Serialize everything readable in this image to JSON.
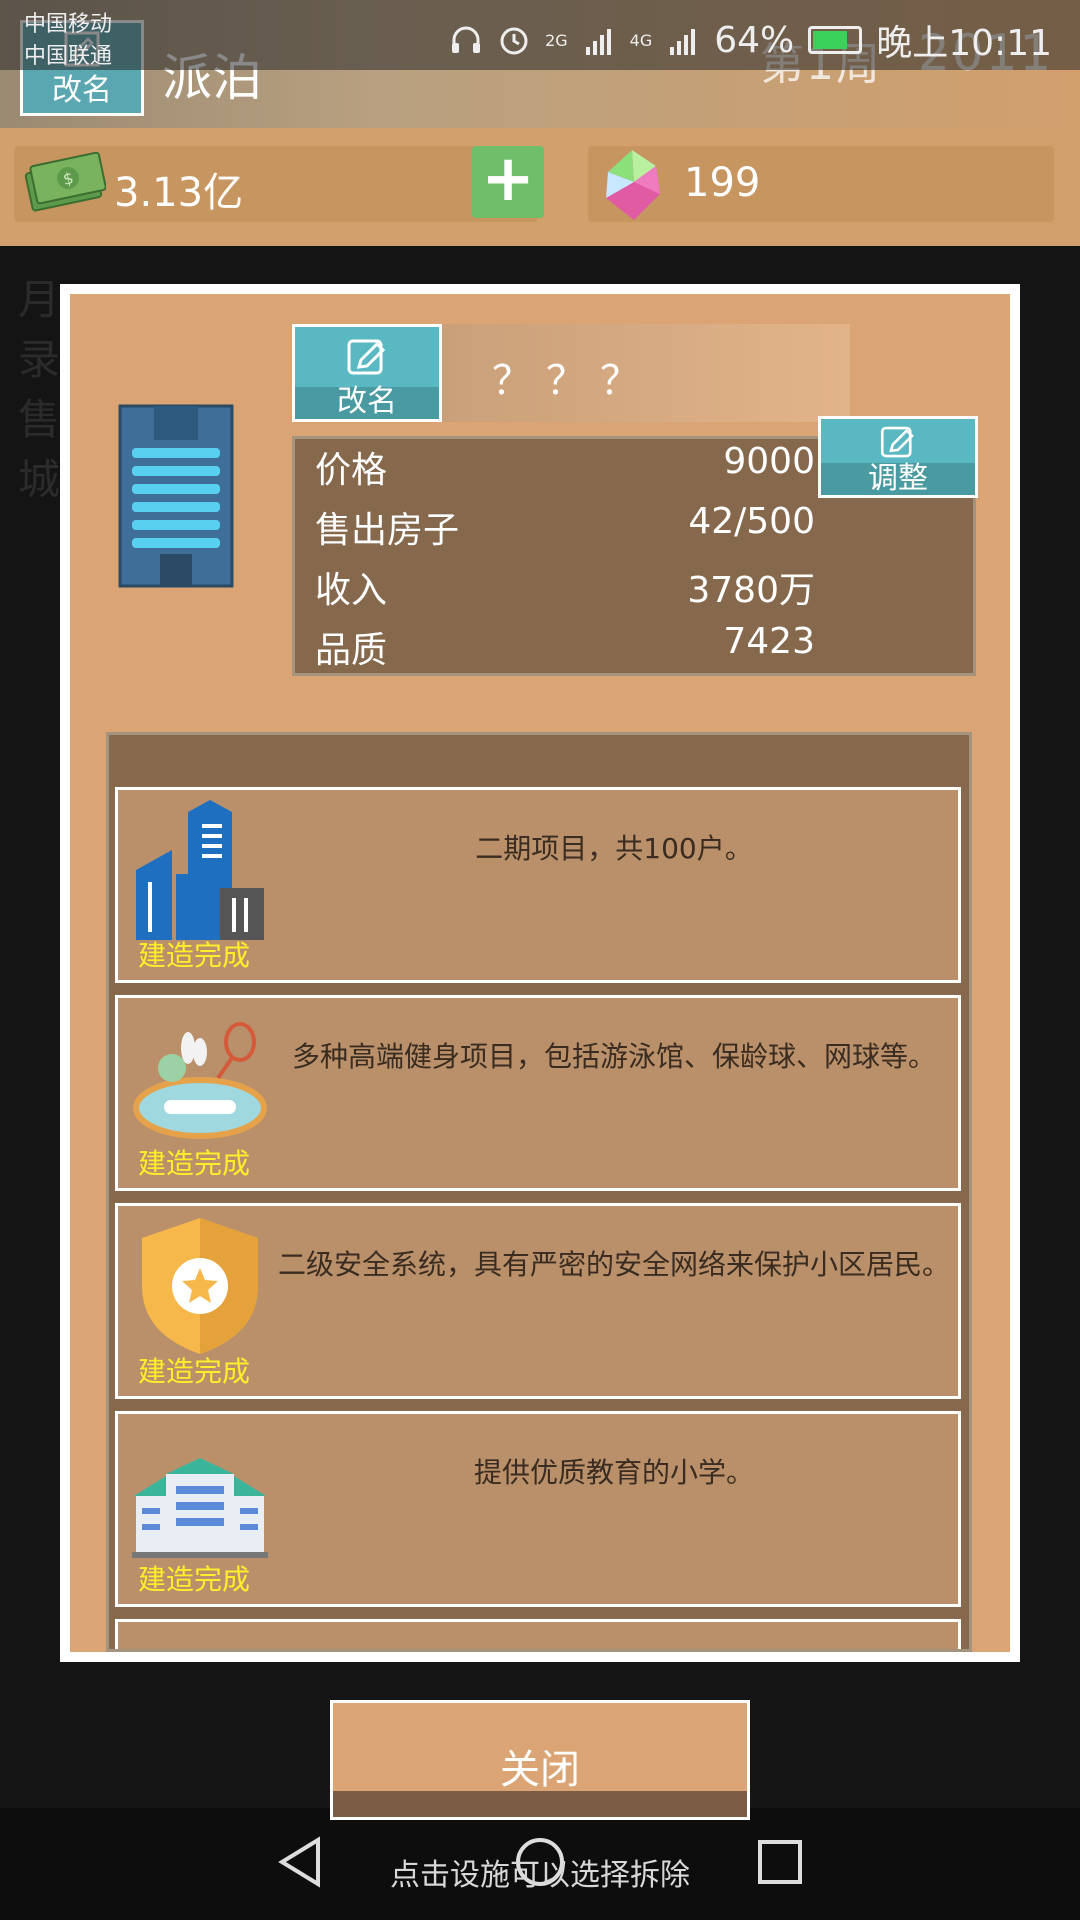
{
  "status_bar": {
    "carrier_1": "中国移动",
    "carrier_2": "中国联通",
    "signal_2g": "2G",
    "signal_4g": "4G",
    "battery_pct": "64%",
    "time": "晚上10:11"
  },
  "header": {
    "rename_label": "改名",
    "company_name": "派泊",
    "week": "第1周",
    "year": "2011",
    "money": "3.13亿",
    "gems": "199"
  },
  "dialog": {
    "rename_label": "改名",
    "project_name": "？？？",
    "adjust_label": "调整",
    "stats": [
      {
        "label": "价格",
        "value": "9000"
      },
      {
        "label": "售出房子",
        "value": "42/500"
      },
      {
        "label": "收入",
        "value": "3780万"
      },
      {
        "label": "品质",
        "value": "7423"
      }
    ],
    "facilities": [
      {
        "icon": "city-buildings-icon",
        "status": "建造完成",
        "desc": "二期项目，共100户。"
      },
      {
        "icon": "fitness-icon",
        "status": "建造完成",
        "desc": "多种高端健身项目，包括游泳馆、保龄球、网球等。"
      },
      {
        "icon": "security-shield-icon",
        "status": "建造完成",
        "desc": "二级安全系统，具有严密的安全网络来保护小区居民。"
      },
      {
        "icon": "school-icon",
        "status": "建造完成",
        "desc": "提供优质教育的小学。"
      }
    ],
    "close_label": "关闭"
  },
  "hint": "点击设施可以选择拆除",
  "colors": {
    "panel_bg": "#dba474",
    "stat_bg": "#86694d",
    "card_bg": "#b9906a",
    "accent_teal": "#5ab8c2",
    "status_yellow": "#ffee2a"
  }
}
